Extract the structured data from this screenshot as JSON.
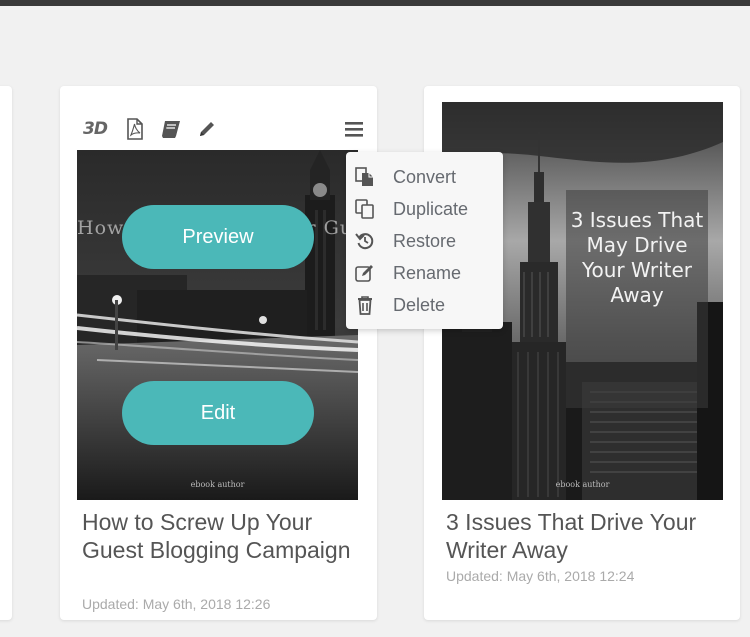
{
  "colors": {
    "accent": "#4bb8b8",
    "background": "#f1f1f1",
    "card": "#ffffff",
    "text": "#555555",
    "muted": "#aaaaaa"
  },
  "cards": [
    {
      "cover_title": "How to Screw Up Your Guest",
      "cover_author": "ebook author",
      "preview_label": "Preview",
      "edit_label": "Edit",
      "title": "How to Screw Up Your Guest Blogging Campaign",
      "updated": "Updated: May 6th, 2018 12:26",
      "toolbar": {
        "three_d": "3D",
        "icons": [
          "pdf-icon",
          "book-icon",
          "pencil-icon"
        ],
        "menu_icon": "hamburger-icon"
      }
    },
    {
      "cover_title": "3 Issues That May Drive Your Writer Away",
      "cover_author": "ebook author",
      "title": "3 Issues That Drive Your Writer Away",
      "updated": "Updated: May 6th, 2018 12:24"
    }
  ],
  "menu": {
    "items": [
      {
        "label": "Convert",
        "icon": "convert-icon"
      },
      {
        "label": "Duplicate",
        "icon": "duplicate-icon"
      },
      {
        "label": "Restore",
        "icon": "restore-icon"
      },
      {
        "label": "Rename",
        "icon": "rename-icon"
      },
      {
        "label": "Delete",
        "icon": "trash-icon"
      }
    ]
  }
}
